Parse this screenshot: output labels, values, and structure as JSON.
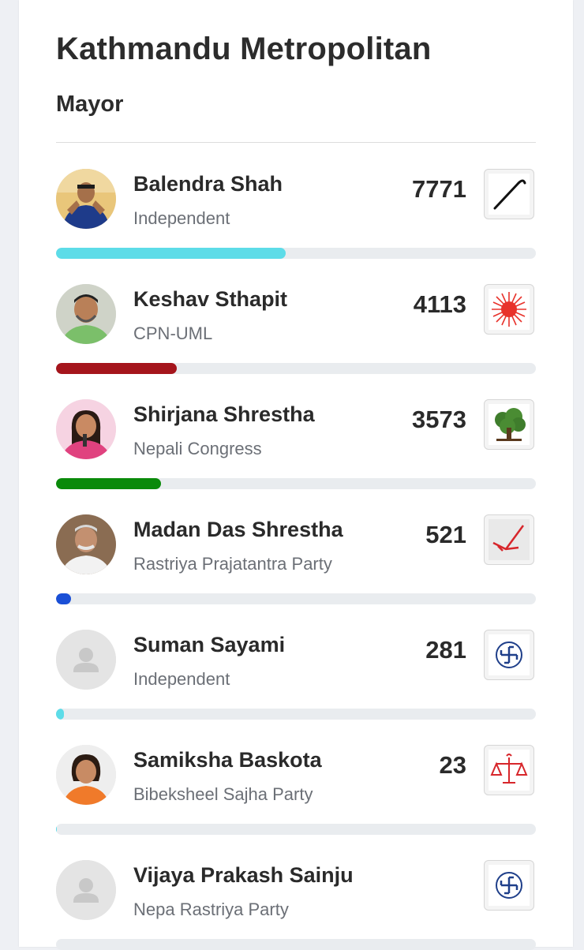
{
  "header": {
    "title": "Kathmandu Metropolitan",
    "subtitle": "Mayor"
  },
  "candidates": [
    {
      "name": "Balendra Shah",
      "party": "Independent",
      "votes": "7771",
      "share": 0.479,
      "bar_color": "#5ddce8",
      "symbol": "walking-stick-icon"
    },
    {
      "name": "Keshav Sthapit",
      "party": "CPN-UML",
      "votes": "4113",
      "share": 0.252,
      "bar_color": "#a5151c",
      "symbol": "sun-icon"
    },
    {
      "name": "Shirjana Shrestha",
      "party": "Nepali Congress",
      "votes": "3573",
      "share": 0.219,
      "bar_color": "#0a8a0a",
      "symbol": "tree-icon"
    },
    {
      "name": "Madan Das Shrestha",
      "party": "Rastriya Prajatantra Party",
      "votes": "521",
      "share": 0.032,
      "bar_color": "#1a4fd6",
      "symbol": "plough-icon"
    },
    {
      "name": "Suman Sayami",
      "party": "Independent",
      "votes": "281",
      "share": 0.017,
      "bar_color": "#5ddce8",
      "symbol": "swastika-icon"
    },
    {
      "name": "Samiksha Baskota",
      "party": "Bibeksheel Sajha Party",
      "votes": "23",
      "share": 0.0015,
      "bar_color": "#5ddce8",
      "symbol": "scales-icon"
    },
    {
      "name": "Vijaya Prakash Sainju",
      "party": "Nepa Rastriya Party",
      "votes": "",
      "share": 0,
      "bar_color": "#5ddce8",
      "symbol": "swastika-icon"
    }
  ]
}
